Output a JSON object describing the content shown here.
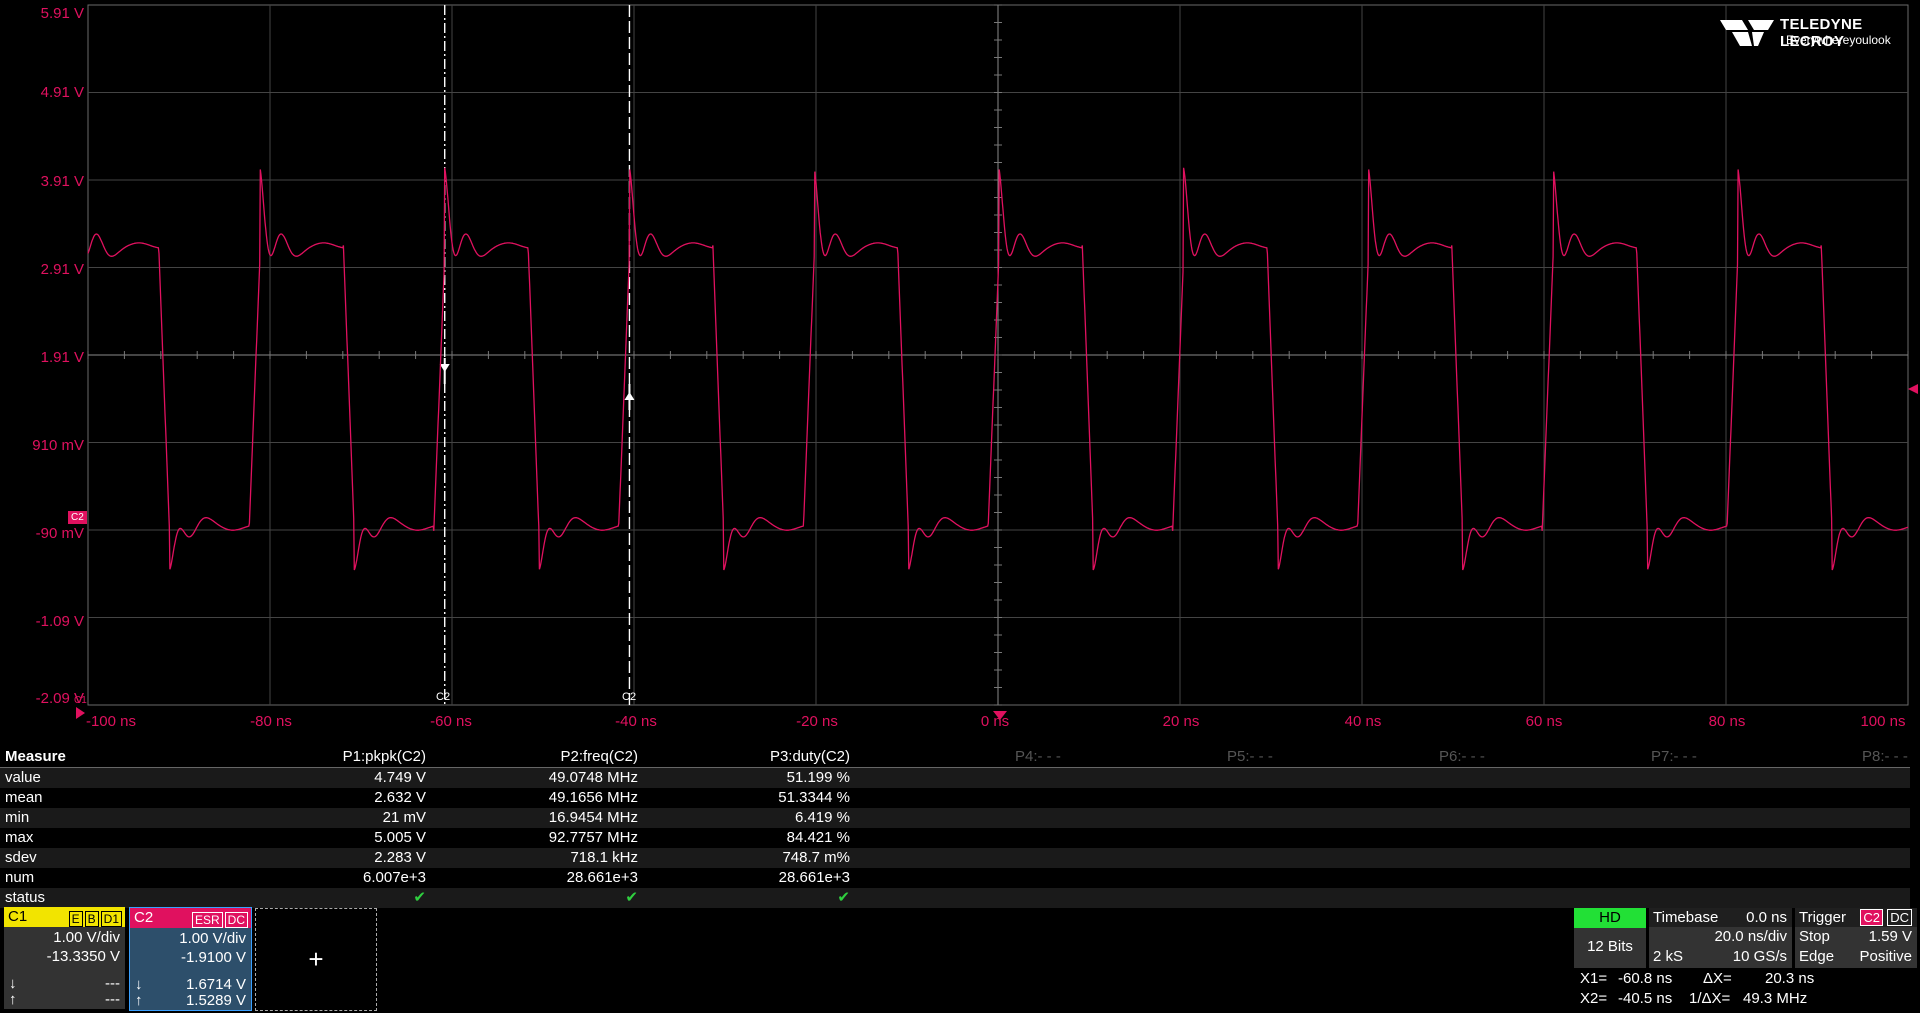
{
  "branding": {
    "company": "TELEDYNE LECROY",
    "tagline": "Everywhereyoulook"
  },
  "chart_data": {
    "type": "line",
    "xlabel": "",
    "ylabel": "",
    "xlim": [
      -100,
      100
    ],
    "ylim": [
      -2.09,
      5.91
    ],
    "y_tick_labels": [
      "5.91 V",
      "4.91 V",
      "3.91 V",
      "2.91 V",
      "1.91 V",
      "910 mV",
      "-90 mV",
      "-1.09 V",
      "-2.09 V"
    ],
    "x_tick_labels": [
      "-100 ns",
      "-80 ns",
      "-60 ns",
      "-40 ns",
      "-20 ns",
      "0 ns",
      "20 ns",
      "40 ns",
      "60 ns",
      "80 ns",
      "100 ns"
    ],
    "series": [
      {
        "name": "C2",
        "color": "#e0115f",
        "period_ns": 20.3,
        "high_v": 3.2,
        "low_v": -0.1,
        "peak_v": 4.1,
        "min_v": -0.6
      }
    ],
    "cursors": [
      {
        "label": "C2",
        "x_ns": -60.8,
        "style": "dash-dot"
      },
      {
        "label": "C2",
        "x_ns": -40.5,
        "style": "dashed"
      }
    ]
  },
  "channel_markers": {
    "c2": "C2",
    "c1": "C1"
  },
  "measure": {
    "title": "Measure",
    "columns": [
      "P1:pkpk(C2)",
      "P2:freq(C2)",
      "P3:duty(C2)"
    ],
    "empty_columns": [
      "P4:- - -",
      "P5:- - -",
      "P6:- - -",
      "P7:- - -",
      "P8:- - -"
    ],
    "rows": [
      {
        "label": "value",
        "v": [
          "4.749 V",
          "49.0748 MHz",
          "51.199 %"
        ]
      },
      {
        "label": "mean",
        "v": [
          "2.632 V",
          "49.1656 MHz",
          "51.3344 %"
        ]
      },
      {
        "label": "min",
        "v": [
          "21 mV",
          "16.9454 MHz",
          "6.419 %"
        ]
      },
      {
        "label": "max",
        "v": [
          "5.005 V",
          "92.7757 MHz",
          "84.421 %"
        ]
      },
      {
        "label": "sdev",
        "v": [
          "2.283 V",
          "718.1 kHz",
          "748.7 m%"
        ]
      },
      {
        "label": "num",
        "v": [
          "6.007e+3",
          "28.661e+3",
          "28.661e+3"
        ]
      },
      {
        "label": "status",
        "v": [
          "✔",
          "✔",
          "✔"
        ]
      }
    ]
  },
  "channels": {
    "c1": {
      "name": "C1",
      "flags": [
        "E",
        "B",
        "D1"
      ],
      "vdiv": "1.00 V/div",
      "offset": "-13.3350 V",
      "cur1": "---",
      "cur2": "---",
      "color": "#f2e400"
    },
    "c2": {
      "name": "C2",
      "flags": [
        "ESR",
        "DC"
      ],
      "vdiv": "1.00 V/div",
      "offset": "-1.9100 V",
      "cur1": "1.6714 V",
      "cur2": "1.5289 V",
      "color": "#e0115f"
    }
  },
  "add_channel": "+",
  "acq": {
    "mode": "HD",
    "bits": "12 Bits"
  },
  "timebase": {
    "label": "Timebase",
    "delay": "0.0 ns",
    "tdiv": "20.0 ns/div",
    "samples": "2 kS",
    "rate": "10 GS/s"
  },
  "trigger": {
    "label": "Trigger",
    "source": "C2",
    "coupling": "DC",
    "mode": "Stop",
    "level": "1.59 V",
    "type": "Edge",
    "slope": "Positive"
  },
  "cursor_readout": {
    "x1_label": "X1=",
    "x1": "-60.8 ns",
    "dx_label": "ΔX=",
    "dx": "20.3 ns",
    "x2_label": "X2=",
    "x2": "-40.5 ns",
    "inv_label": "1/ΔX=",
    "inv": "49.3 MHz"
  },
  "arrows": {
    "down": "↓",
    "up": "↑"
  }
}
